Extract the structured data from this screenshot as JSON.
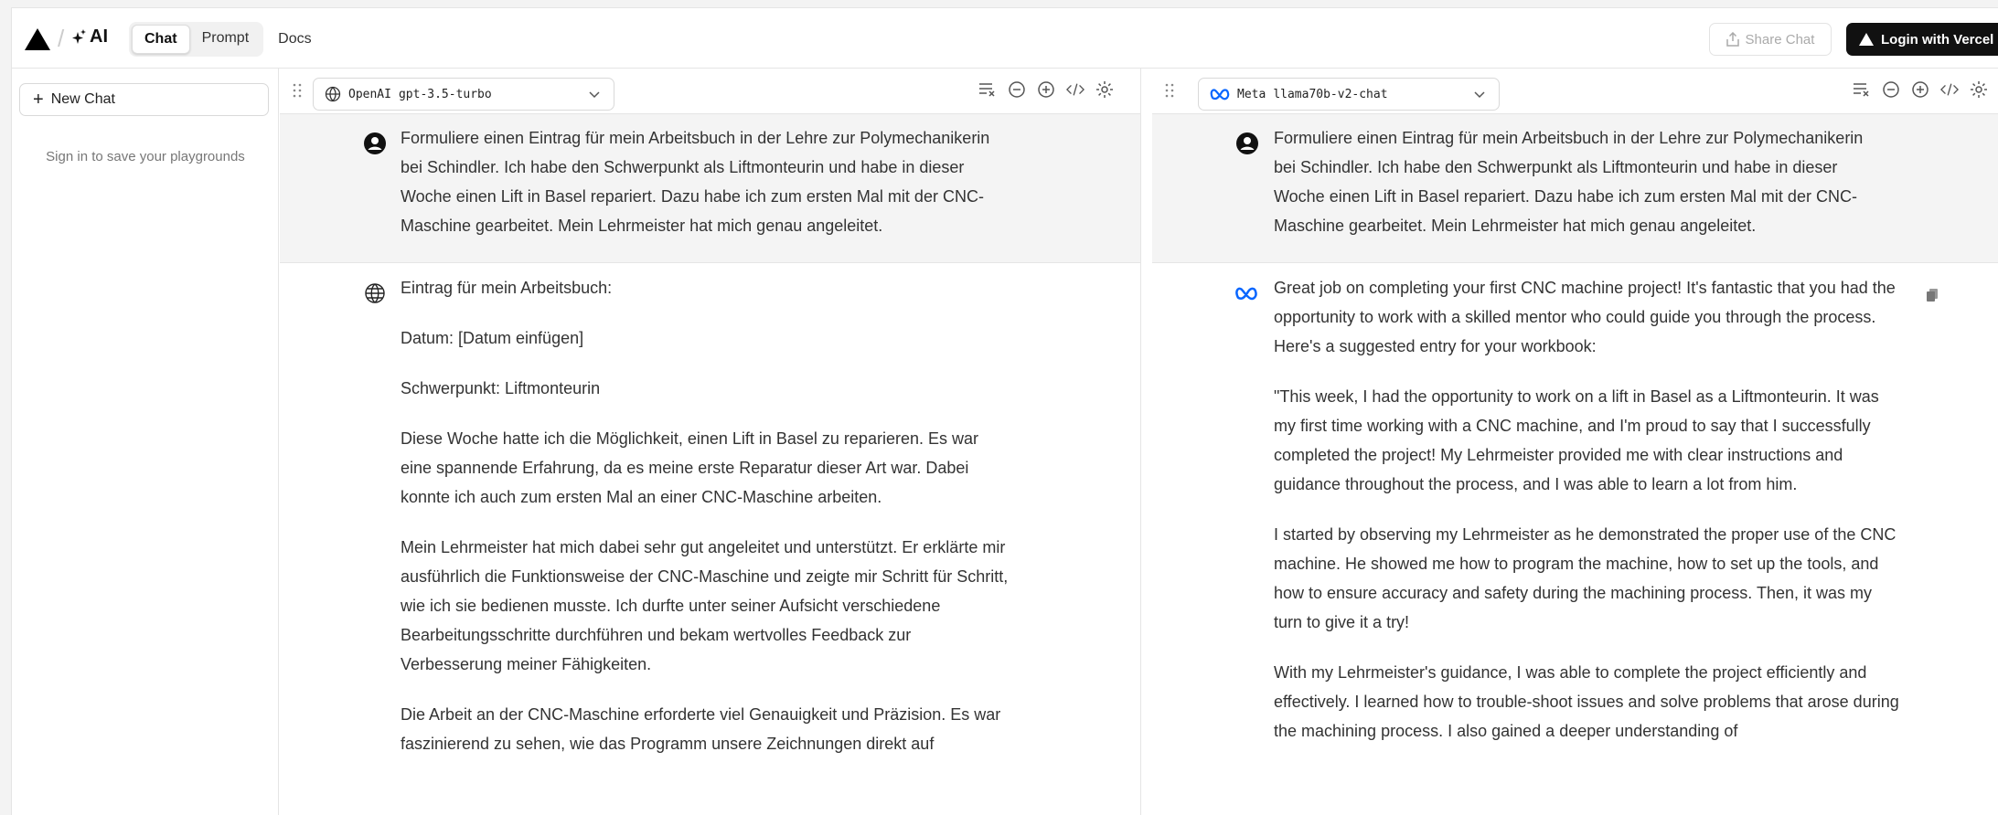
{
  "header": {
    "brand": "AI",
    "tabs": [
      {
        "label": "Chat",
        "active": true
      },
      {
        "label": "Prompt",
        "active": false
      }
    ],
    "docs_label": "Docs",
    "share_label": "Share Chat",
    "login_label": "Login with Vercel"
  },
  "sidebar": {
    "new_chat_label": "New Chat",
    "sign_in_text": "Sign in to save your playgrounds"
  },
  "left": {
    "provider": "OpenAI",
    "model": "gpt-3.5-turbo",
    "user_message": "Formuliere einen Eintrag für mein Arbeitsbuch in der Lehre zur Polymechanikerin bei Schindler. Ich habe den Schwerpunkt als Liftmonteurin und habe in dieser Woche einen Lift in Basel repariert. Dazu habe ich zum ersten Mal mit der CNC-Maschine gearbeitet. Mein Lehrmeister hat mich genau angeleitet.",
    "assistant_paragraphs": [
      "Eintrag für mein Arbeitsbuch:",
      "Datum: [Datum einfügen]",
      "Schwerpunkt: Liftmonteurin",
      "Diese Woche hatte ich die Möglichkeit, einen Lift in Basel zu reparieren. Es war eine spannende Erfahrung, da es meine erste Reparatur dieser Art war. Dabei konnte ich auch zum ersten Mal an einer CNC-Maschine arbeiten.",
      "Mein Lehrmeister hat mich dabei sehr gut angeleitet und unterstützt. Er erklärte mir ausführlich die Funktionsweise der CNC-Maschine und zeigte mir Schritt für Schritt, wie ich sie bedienen musste. Ich durfte unter seiner Aufsicht verschiedene Bearbeitungsschritte durchführen und bekam wertvolles Feedback zur Verbesserung meiner Fähigkeiten.",
      "Die Arbeit an der CNC-Maschine erforderte viel Genauigkeit und Präzision. Es war faszinierend zu sehen, wie das Programm unsere Zeichnungen direkt auf"
    ]
  },
  "right": {
    "provider": "Meta",
    "model": "llama70b-v2-chat",
    "user_message": "Formuliere einen Eintrag für mein Arbeitsbuch in der Lehre zur Polymechanikerin bei Schindler. Ich habe den Schwerpunkt als Liftmonteurin und habe in dieser Woche einen Lift in Basel repariert. Dazu habe ich zum ersten Mal mit der CNC-Maschine gearbeitet. Mein Lehrmeister hat mich genau angeleitet.",
    "assistant_paragraphs": [
      "Great job on completing your first CNC machine project! It's fantastic that you had the opportunity to work with a skilled mentor who could guide you through the process. Here's a suggested entry for your workbook:",
      "\"This week, I had the opportunity to work on a lift in Basel as a Liftmonteurin. It was my first time working with a CNC machine, and I'm proud to say that I successfully completed the project! My Lehrmeister provided me with clear instructions and guidance throughout the process, and I was able to learn a lot from him.",
      "I started by observing my Lehrmeister as he demonstrated the proper use of the CNC machine. He showed me how to program the machine, how to set up the tools, and how to ensure accuracy and safety during the machining process. Then, it was my turn to give it a try!",
      "With my Lehrmeister's guidance, I was able to complete the project efficiently and effectively. I learned how to trouble-shoot issues and solve problems that arose during the machining process. I also gained a deeper understanding of"
    ]
  }
}
